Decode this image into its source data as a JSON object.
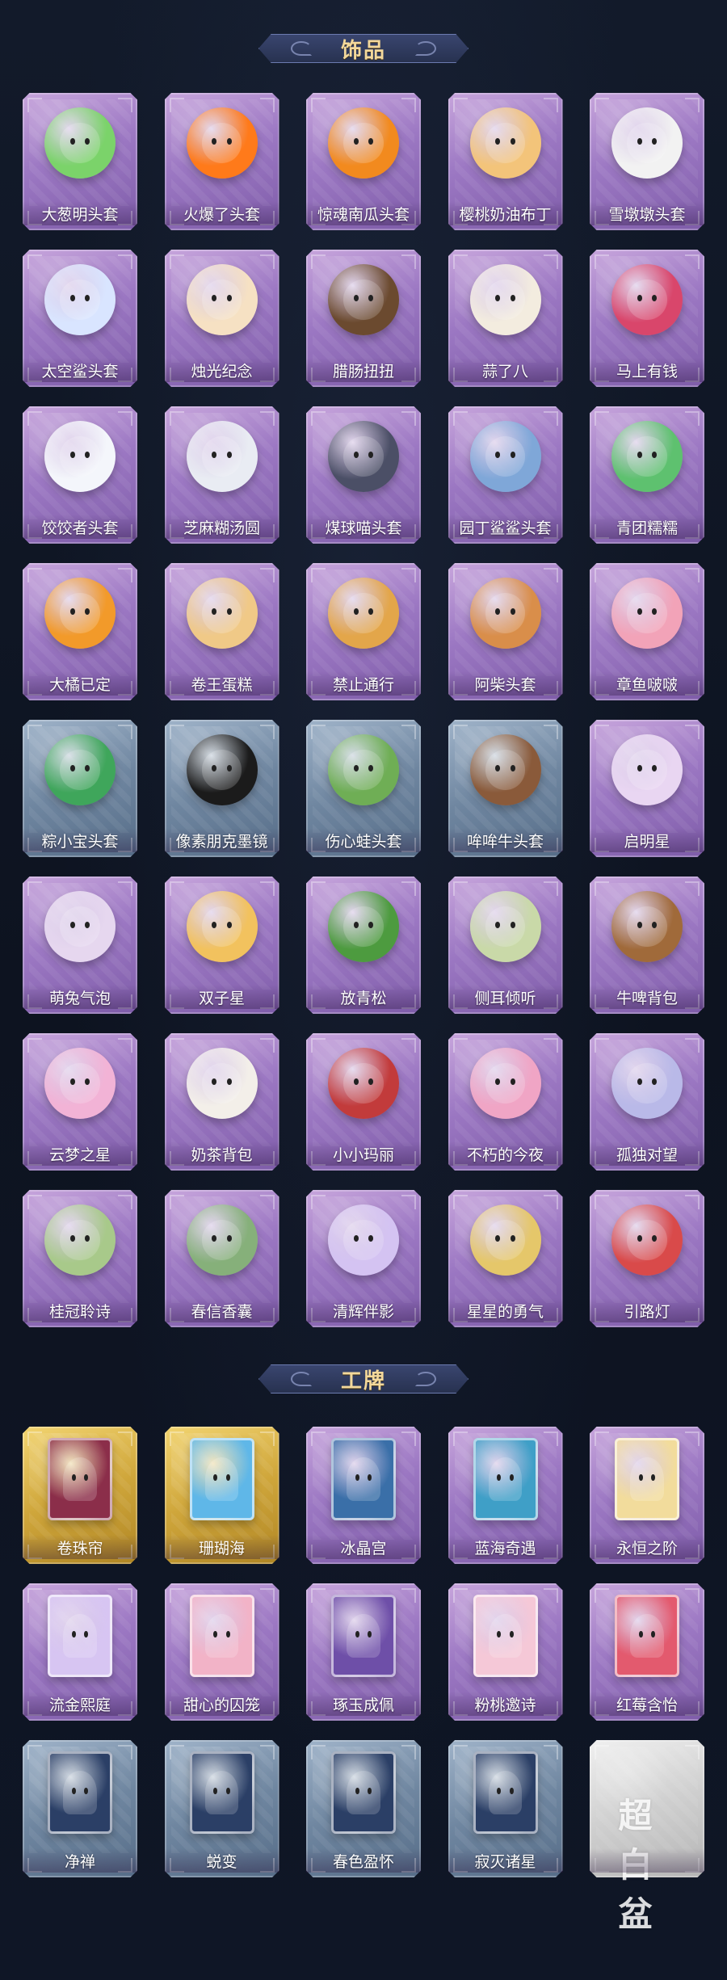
{
  "sections": [
    {
      "title": "饰品",
      "items": [
        {
          "label": "大葱明头套",
          "color": "#7bd36a",
          "frame": "purple"
        },
        {
          "label": "火爆了头套",
          "color": "#ff7a1a",
          "frame": "purple"
        },
        {
          "label": "惊魂南瓜头套",
          "color": "#f28a1e",
          "frame": "purple"
        },
        {
          "label": "樱桃奶油布丁",
          "color": "#f3c47a",
          "frame": "purple"
        },
        {
          "label": "雪墩墩头套",
          "color": "#f2f2f2",
          "frame": "purple"
        },
        {
          "label": "太空鲨头套",
          "color": "#d9e5ff",
          "frame": "purple"
        },
        {
          "label": "烛光纪念",
          "color": "#f6e1c3",
          "frame": "purple"
        },
        {
          "label": "腊肠扭扭",
          "color": "#6b4a2f",
          "frame": "purple"
        },
        {
          "label": "蒜了八",
          "color": "#f3ecdf",
          "frame": "purple"
        },
        {
          "label": "马上有钱",
          "color": "#d9466b",
          "frame": "purple"
        },
        {
          "label": "饺饺者头套",
          "color": "#f4f6fb",
          "frame": "purple"
        },
        {
          "label": "芝麻糊汤圆",
          "color": "#e9ecf3",
          "frame": "purple"
        },
        {
          "label": "煤球喵头套",
          "color": "#4b4f66",
          "frame": "purple"
        },
        {
          "label": "园丁鲨鲨头套",
          "color": "#7fa7d8",
          "frame": "purple"
        },
        {
          "label": "青团糯糯",
          "color": "#5ec16f",
          "frame": "purple"
        },
        {
          "label": "大橘已定",
          "color": "#f29a2a",
          "frame": "purple"
        },
        {
          "label": "卷王蛋糕",
          "color": "#f0c987",
          "frame": "purple"
        },
        {
          "label": "禁止通行",
          "color": "#e3a64a",
          "frame": "purple"
        },
        {
          "label": "阿柴头套",
          "color": "#d98e4a",
          "frame": "purple"
        },
        {
          "label": "章鱼啵啵",
          "color": "#f2a3b8",
          "frame": "purple"
        },
        {
          "label": "粽小宝头套",
          "color": "#3fa65b",
          "frame": "blue"
        },
        {
          "label": "像素朋克墨镜",
          "color": "#1b1b1b",
          "frame": "blue"
        },
        {
          "label": "伤心蛙头套",
          "color": "#6fae55",
          "frame": "blue"
        },
        {
          "label": "哞哞牛头套",
          "color": "#8a5a3a",
          "frame": "blue"
        },
        {
          "label": "启明星",
          "color": "#e9d6f2",
          "frame": "purple"
        },
        {
          "label": "萌兔气泡",
          "color": "#e6d7ef",
          "frame": "purple"
        },
        {
          "label": "双子星",
          "color": "#f2c25e",
          "frame": "purple"
        },
        {
          "label": "放青松",
          "color": "#4d9b3f",
          "frame": "purple"
        },
        {
          "label": "侧耳倾听",
          "color": "#c9d9a8",
          "frame": "purple"
        },
        {
          "label": "牛啤背包",
          "color": "#a06a3a",
          "frame": "purple"
        },
        {
          "label": "云梦之星",
          "color": "#f2b3d6",
          "frame": "purple"
        },
        {
          "label": "奶茶背包",
          "color": "#f3efe9",
          "frame": "purple"
        },
        {
          "label": "小小玛丽",
          "color": "#c23b3b",
          "frame": "purple"
        },
        {
          "label": "不朽的今夜",
          "color": "#f0a5c5",
          "frame": "purple"
        },
        {
          "label": "孤独对望",
          "color": "#b9b9e8",
          "frame": "purple"
        },
        {
          "label": "桂冠聆诗",
          "color": "#a8c98a",
          "frame": "purple"
        },
        {
          "label": "春信香囊",
          "color": "#86b07a",
          "frame": "purple"
        },
        {
          "label": "清辉伴影",
          "color": "#d4c3f2",
          "frame": "purple"
        },
        {
          "label": "星星的勇气",
          "color": "#e5c76a",
          "frame": "purple"
        },
        {
          "label": "引路灯",
          "color": "#d94a4a",
          "frame": "purple"
        }
      ]
    },
    {
      "title": "工牌",
      "items": [
        {
          "label": "卷珠帘",
          "color": "#8b2e4a",
          "frame": "gold"
        },
        {
          "label": "珊瑚海",
          "color": "#5fb7e8",
          "frame": "gold"
        },
        {
          "label": "冰晶宫",
          "color": "#3a6fa8",
          "frame": "purple"
        },
        {
          "label": "蓝海奇遇",
          "color": "#3f9fc7",
          "frame": "purple"
        },
        {
          "label": "永恒之阶",
          "color": "#f2dc9c",
          "frame": "purple"
        },
        {
          "label": "流金熙庭",
          "color": "#d7c5f2",
          "frame": "purple"
        },
        {
          "label": "甜心的囚笼",
          "color": "#f2b3c7",
          "frame": "purple"
        },
        {
          "label": "琢玉成佩",
          "color": "#6e4fa8",
          "frame": "purple"
        },
        {
          "label": "粉桃邀诗",
          "color": "#f5c8d7",
          "frame": "purple"
        },
        {
          "label": "红莓含怡",
          "color": "#e35a6e",
          "frame": "purple"
        },
        {
          "label": "净禅",
          "color": "#2b3f66",
          "frame": "blue"
        },
        {
          "label": "蜕变",
          "color": "#2b3f66",
          "frame": "blue"
        },
        {
          "label": "春色盈怀",
          "color": "#2b3f66",
          "frame": "blue"
        },
        {
          "label": "寂灭诸星",
          "color": "#2b3f66",
          "frame": "blue"
        },
        {
          "label": "",
          "color": "#d8d8d8",
          "frame": "silver",
          "logo": "超白盆"
        }
      ]
    }
  ]
}
